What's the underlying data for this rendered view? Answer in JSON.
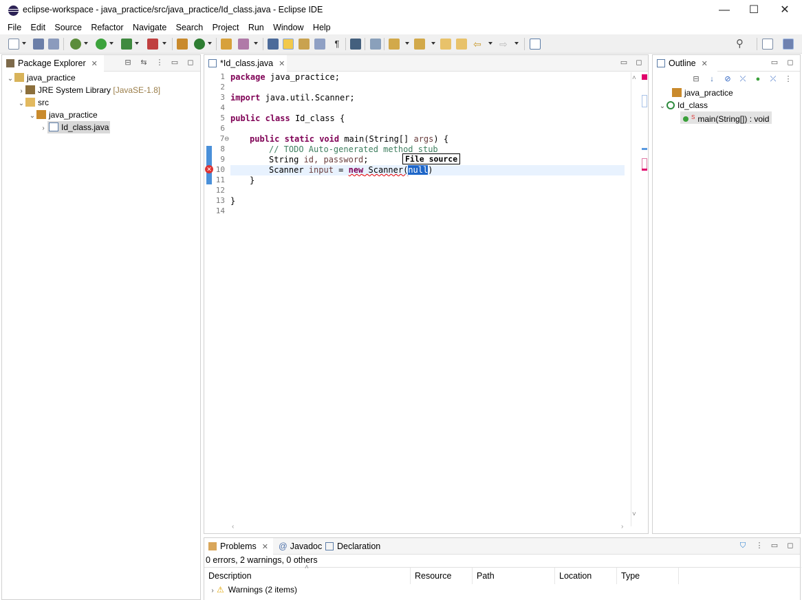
{
  "window": {
    "title": "eclipse-workspace - java_practice/src/java_practice/Id_class.java - Eclipse IDE",
    "controls": {
      "minimize": "—",
      "maximize": "☐",
      "close": "✕"
    }
  },
  "menu": [
    "File",
    "Edit",
    "Source",
    "Refactor",
    "Navigate",
    "Search",
    "Project",
    "Run",
    "Window",
    "Help"
  ],
  "package_explorer": {
    "tab_label": "Package Explorer",
    "tree": {
      "project": "java_practice",
      "jre": "JRE System Library",
      "jre_version": "[JavaSE-1.8]",
      "src": "src",
      "package": "java_practice",
      "file": "Id_class.java"
    }
  },
  "editor": {
    "tab_label": "*Id_class.java",
    "lines": [
      {
        "n": "1"
      },
      {
        "n": "2"
      },
      {
        "n": "3"
      },
      {
        "n": "4"
      },
      {
        "n": "5"
      },
      {
        "n": "6"
      },
      {
        "n": "7⊖"
      },
      {
        "n": "8"
      },
      {
        "n": "9"
      },
      {
        "n": "10"
      },
      {
        "n": "11"
      },
      {
        "n": "12"
      },
      {
        "n": "13"
      },
      {
        "n": "14"
      }
    ],
    "code": {
      "l1_kw": "package",
      "l1_rest": " java_practice;",
      "l3_kw": "import",
      "l3_rest": " java.util.Scanner;",
      "l5_kw1": "public",
      "l5_kw2": "class",
      "l5_rest": " Id_class {",
      "l7_kw1": "public",
      "l7_kw2": "static",
      "l7_kw3": "void",
      "l7_rest": " main(String[] ",
      "l7_var": "args",
      "l7_end": ") {",
      "l8_comment": "// TODO Auto-generated method stub",
      "l9_pre": "String ",
      "l9_vars": "id, password",
      "l9_end": ";",
      "l10_pre": "Scanner ",
      "l10_var": "input",
      "l10_eq": " = ",
      "l10_new": "new",
      "l10_ctor": " Scanner(",
      "l10_null": "null",
      "l10_end": ")",
      "l11": "}",
      "l13": "}"
    },
    "tooltip": "File source"
  },
  "outline": {
    "tab_label": "Outline",
    "package": "java_practice",
    "class": "Id_class",
    "method": "main(String[]) : void"
  },
  "problems": {
    "tabs": [
      "Problems",
      "Javadoc",
      "Declaration"
    ],
    "summary": "0 errors, 2 warnings, 0 others",
    "columns": [
      "Description",
      "Resource",
      "Path",
      "Location",
      "Type"
    ],
    "rows": [
      {
        "description": "Warnings (2 items)"
      }
    ]
  }
}
